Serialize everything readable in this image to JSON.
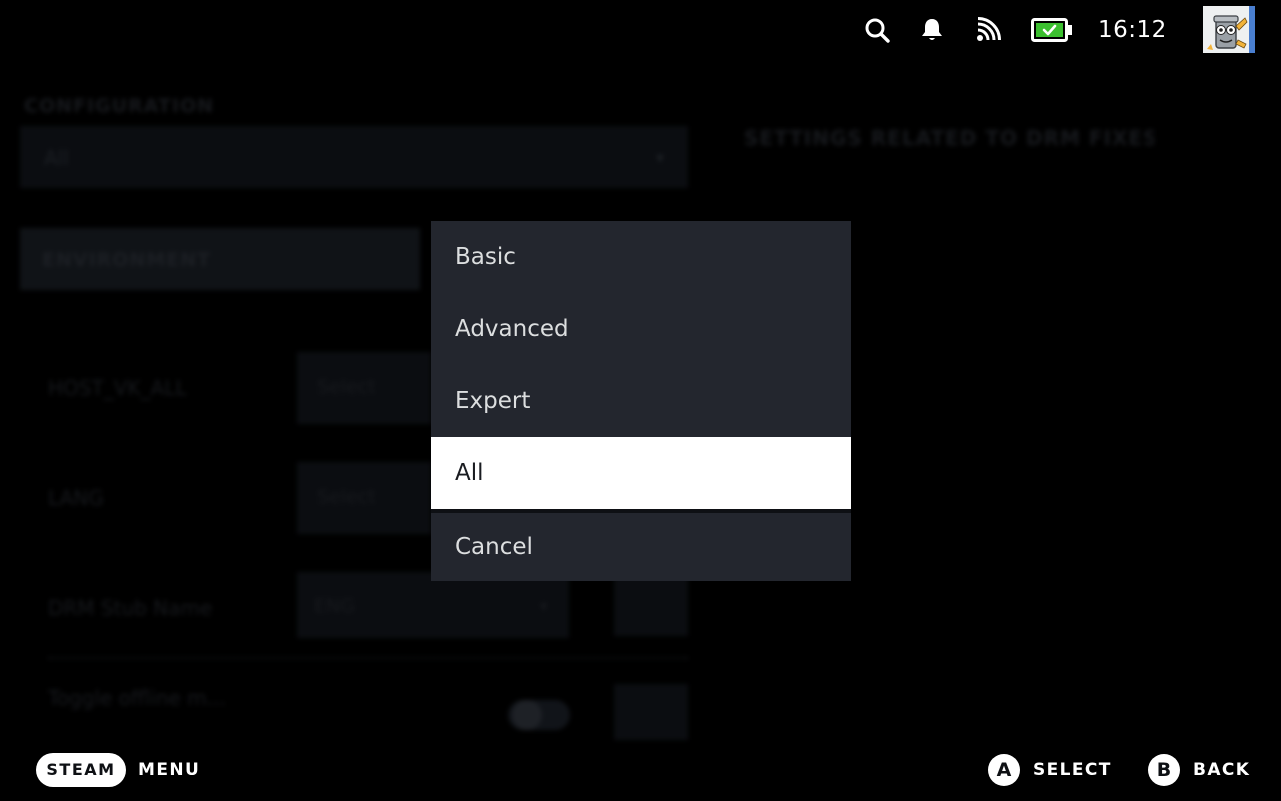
{
  "status_bar": {
    "clock": "16:12",
    "icons": [
      "search-icon",
      "bell-icon",
      "cast-icon",
      "battery-icon"
    ],
    "battery_color": "#3bbf2f"
  },
  "background": {
    "section_title": "CONFIGURATION",
    "config_value": "All",
    "subheader": "ENVIRONMENT",
    "right_header": "SETTINGS RELATED TO DRM FIXES",
    "rows": [
      {
        "label": "HOST_VK_ALL",
        "value": "Select"
      },
      {
        "label": "LANG",
        "value": "Select"
      },
      {
        "label": "DRM Stub Name",
        "value": "ENG"
      },
      {
        "label": "Toggle offline m..."
      }
    ]
  },
  "menu": {
    "options": [
      "Basic",
      "Advanced",
      "Expert",
      "All"
    ],
    "selected": "All",
    "cancel": "Cancel"
  },
  "footer": {
    "steam": "STEAM",
    "menu": "MENU",
    "a_glyph": "A",
    "select": "SELECT",
    "b_glyph": "B",
    "back": "BACK"
  }
}
